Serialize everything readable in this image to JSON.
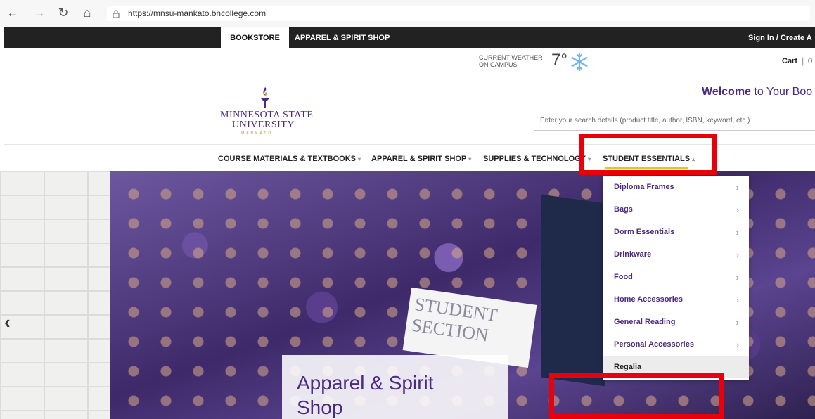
{
  "browser": {
    "url": "https://mnsu-mankato.bncollege.com",
    "back_icon": "arrow-left-icon",
    "forward_icon": "arrow-right-icon",
    "reload_icon": "reload-icon",
    "home_icon": "home-icon"
  },
  "topbar": {
    "tab_bookstore": "BOOKSTORE",
    "tab_apparel": "APPAREL & SPIRIT SHOP",
    "sign_in": "Sign In / Create A"
  },
  "weather": {
    "label_line1": "CURRENT WEATHER",
    "label_line2": "ON CAMPUS",
    "temp": "7°",
    "icon": "snowflake-icon"
  },
  "cart": {
    "label": "Cart",
    "separator": "|",
    "count": "0"
  },
  "logo": {
    "line1": "MINNESOTA STATE",
    "line2": "UNIVERSITY",
    "line3": "MANKATO"
  },
  "welcome": {
    "bold": "Welcome",
    "rest": " to Your Boo"
  },
  "search": {
    "placeholder": "Enter your search details (product title, author, ISBN, keyword, etc.)"
  },
  "nav": {
    "items": [
      {
        "label": "COURSE MATERIALS & TEXTBOOKS",
        "caret": "▾"
      },
      {
        "label": "APPAREL & SPIRIT SHOP",
        "caret": "▾"
      },
      {
        "label": "SUPPLIES & TECHNOLOGY",
        "caret": "▾"
      },
      {
        "label": "STUDENT ESSENTIALS",
        "caret": "▴"
      }
    ]
  },
  "hero": {
    "prev_label": "‹",
    "sign_text": "STUDENT SECTION",
    "promo_title": "Apparel & Spirit Shop"
  },
  "dropdown": {
    "items": [
      {
        "label": "Diploma Frames",
        "chev": "›"
      },
      {
        "label": "Bags",
        "chev": "›"
      },
      {
        "label": "Dorm Essentials",
        "chev": "›"
      },
      {
        "label": "Drinkware",
        "chev": "›"
      },
      {
        "label": "Food",
        "chev": "›"
      },
      {
        "label": "Home Accessories",
        "chev": "›"
      },
      {
        "label": "General Reading",
        "chev": "›"
      },
      {
        "label": "Personal Accessories",
        "chev": "›"
      },
      {
        "label": "Regalia",
        "chev": ""
      }
    ]
  },
  "colors": {
    "brand_purple": "#4b2a83",
    "accent_gold": "#e8c21d",
    "highlight_red": "#e8000b",
    "topbar_black": "#222222"
  }
}
